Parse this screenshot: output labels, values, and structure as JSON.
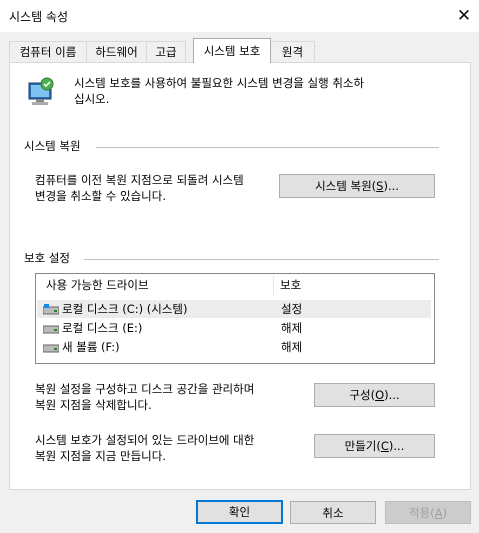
{
  "window": {
    "title": "시스템 속성",
    "close_glyph": "✕"
  },
  "tabs": [
    {
      "label": "컴퓨터 이름"
    },
    {
      "label": "하드웨어"
    },
    {
      "label": "고급"
    },
    {
      "label": "시스템 보호"
    },
    {
      "label": "원격"
    }
  ],
  "intro": {
    "line1": "시스템 보호를 사용하여 불필요한 시스템 변경을 실행 취소하",
    "line2": "십시오."
  },
  "restore": {
    "section_title": "시스템 복원",
    "desc_line1": "컴퓨터를 이전 복원 지점으로 되돌려 시스템",
    "desc_line2": "변경을 취소할 수 있습니다.",
    "button_pre": "시스템 복원(",
    "button_key": "S",
    "button_post": ")..."
  },
  "protection": {
    "section_title": "보호 설정",
    "col_drive": "사용 가능한 드라이브",
    "col_protect": "보호",
    "drives": [
      {
        "name": "로컬 디스크 (C:) (시스템)",
        "status": "설정",
        "icon": "system-drive-icon"
      },
      {
        "name": "로컬 디스크 (E:)",
        "status": "해제",
        "icon": "drive-icon"
      },
      {
        "name": "새 볼륨 (F:)",
        "status": "해제",
        "icon": "drive-icon"
      }
    ],
    "config_line1": "복원 설정을 구성하고 디스크 공간을 관리하며",
    "config_line2": "복원 지점을 삭제합니다.",
    "config_pre": "구성(",
    "config_key": "O",
    "config_post": ")...",
    "create_line1": "시스템 보호가 설정되어 있는 드라이브에 대한",
    "create_line2": "복원 지점을 지금 만듭니다.",
    "create_pre": "만들기(",
    "create_key": "C",
    "create_post": ")..."
  },
  "footer": {
    "ok": "확인",
    "cancel": "취소",
    "apply_pre": "적용(",
    "apply_key": "A",
    "apply_post": ")"
  },
  "colors": {
    "accent": "#0078d7",
    "panel": "#ffffff",
    "chrome": "#f0f0f0"
  }
}
